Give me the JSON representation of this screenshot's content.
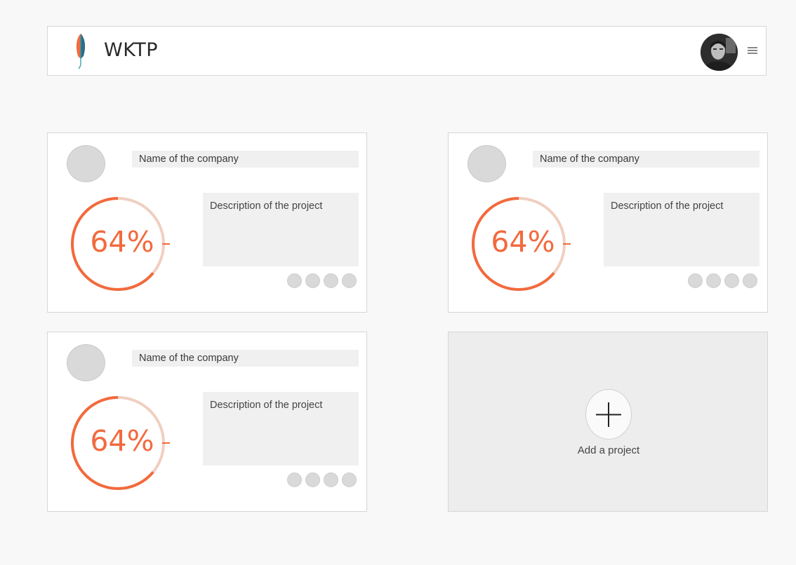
{
  "header": {
    "app_title": "WKTP",
    "logo_icon": "feather-logo-icon",
    "menu_icon": "hamburger-menu-icon"
  },
  "projects": [
    {
      "company_name": "Name of the company",
      "progress_label": "64%",
      "progress": 0.64,
      "description": "Description of the project"
    },
    {
      "company_name": "Name of the company",
      "progress_label": "64%",
      "progress": 0.64,
      "description": "Description of the project"
    },
    {
      "company_name": "Name of the company",
      "progress_label": "64%",
      "progress": 0.64,
      "description": "Description of the project"
    }
  ],
  "add_project": {
    "label": "Add a project",
    "icon": "plus-icon"
  },
  "colors": {
    "accent": "#f26a3d",
    "ring_track": "#f0cfc1",
    "page_bg": "#f8f8f8",
    "card_bg": "#ffffff",
    "placeholder": "#f0f0f0"
  }
}
